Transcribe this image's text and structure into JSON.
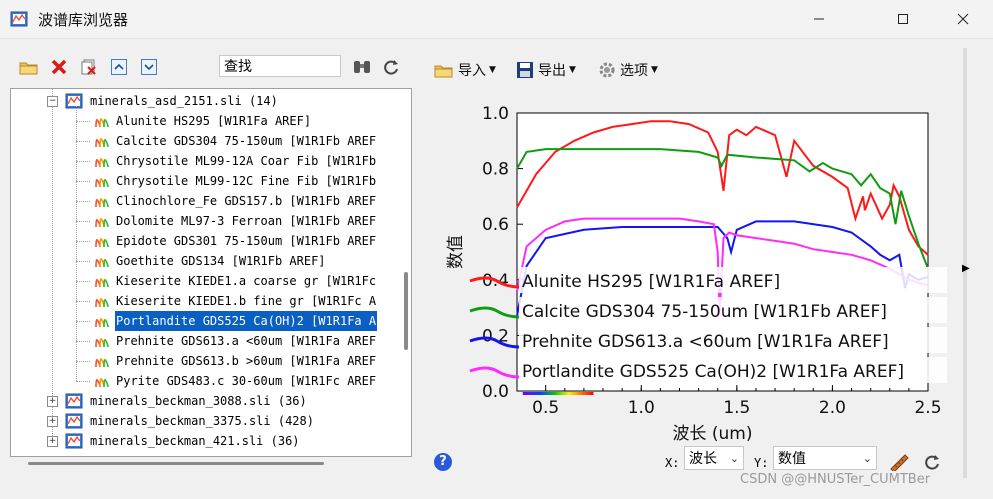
{
  "window": {
    "title": "波谱库浏览器"
  },
  "left_toolbar": {
    "search_value": "查找"
  },
  "tree": {
    "rows": [
      {
        "label": "minerals_asd_2151.sli  (14)",
        "level": 1,
        "kind": "lib",
        "expanded": true
      },
      {
        "label": "Alunite HS295 [W1R1Fa AREF]",
        "level": 2,
        "kind": "spec"
      },
      {
        "label": "Calcite GDS304 75-150um [W1R1Fb AREF",
        "level": 2,
        "kind": "spec"
      },
      {
        "label": "Chrysotile ML99-12A Coar Fib [W1R1Fb",
        "level": 2,
        "kind": "spec"
      },
      {
        "label": "Chrysotile ML99-12C Fine Fib [W1R1Fb",
        "level": 2,
        "kind": "spec"
      },
      {
        "label": "Clinochlore_Fe GDS157.b [W1R1Fb AREF",
        "level": 2,
        "kind": "spec"
      },
      {
        "label": "Dolomite ML97-3 Ferroan [W1R1Fb AREF",
        "level": 2,
        "kind": "spec"
      },
      {
        "label": "Epidote GDS301 75-150um [W1R1Fb AREF",
        "level": 2,
        "kind": "spec"
      },
      {
        "label": "Goethite GDS134 [W1R1Fb AREF]",
        "level": 2,
        "kind": "spec"
      },
      {
        "label": "Kieserite KIEDE1.a coarse gr [W1R1Fc",
        "level": 2,
        "kind": "spec"
      },
      {
        "label": "Kieserite KIEDE1.b fine gr [W1R1Fc A",
        "level": 2,
        "kind": "spec"
      },
      {
        "label": "Portlandite GDS525 Ca(OH)2 [W1R1Fa A",
        "level": 2,
        "kind": "spec",
        "selected": true
      },
      {
        "label": "Prehnite GDS613.a <60um [W1R1Fa AREF",
        "level": 2,
        "kind": "spec"
      },
      {
        "label": "Prehnite GDS613.b >60um [W1R1Fa AREF",
        "level": 2,
        "kind": "spec"
      },
      {
        "label": "Pyrite GDS483.c 30-60um [W1R1Fc AREF",
        "level": 2,
        "kind": "spec"
      },
      {
        "label": "minerals_beckman_3088.sli  (36)",
        "level": 1,
        "kind": "lib",
        "expanded": false
      },
      {
        "label": "minerals_beckman_3375.sli  (428)",
        "level": 1,
        "kind": "lib",
        "expanded": false
      },
      {
        "label": "minerals_beckman_421.sli  (36)",
        "level": 1,
        "kind": "lib",
        "expanded": false
      }
    ]
  },
  "menus": {
    "import": "导入",
    "export": "导出",
    "options": "选项"
  },
  "chart_data": {
    "type": "line",
    "xlabel": "波长 (um)",
    "ylabel": "数值",
    "xlim": [
      0.35,
      2.5
    ],
    "ylim": [
      0.0,
      1.0
    ],
    "xticks": [
      "0.5",
      "1.0",
      "1.5",
      "2.0",
      "2.5"
    ],
    "xtick_values": [
      0.5,
      1.0,
      1.5,
      2.0,
      2.5
    ],
    "yticks": [
      "0.0",
      "0.2",
      "0.4",
      "0.6",
      "0.8",
      "1.0"
    ],
    "ytick_values": [
      0.0,
      0.2,
      0.4,
      0.6,
      0.8,
      1.0
    ],
    "legend_placement": "bottom-left",
    "series": [
      {
        "name": "Alunite HS295 [W1R1Fa AREF]",
        "color": "#ff1a1a",
        "x": [
          0.35,
          0.45,
          0.55,
          0.65,
          0.75,
          0.85,
          0.95,
          1.05,
          1.15,
          1.25,
          1.35,
          1.4,
          1.43,
          1.46,
          1.5,
          1.55,
          1.6,
          1.7,
          1.76,
          1.8,
          1.9,
          2.0,
          2.08,
          2.12,
          2.16,
          2.17,
          2.2,
          2.26,
          2.3,
          2.32,
          2.35,
          2.4,
          2.45,
          2.5
        ],
        "y": [
          0.66,
          0.78,
          0.86,
          0.9,
          0.93,
          0.95,
          0.96,
          0.97,
          0.97,
          0.96,
          0.93,
          0.86,
          0.72,
          0.92,
          0.94,
          0.92,
          0.95,
          0.92,
          0.77,
          0.9,
          0.81,
          0.77,
          0.73,
          0.62,
          0.7,
          0.65,
          0.71,
          0.62,
          0.67,
          0.74,
          0.7,
          0.58,
          0.52,
          0.49
        ]
      },
      {
        "name": "Calcite GDS304 75-150um [W1R1Fb AREF]",
        "color": "#109c10",
        "x": [
          0.35,
          0.4,
          0.5,
          0.7,
          0.9,
          1.1,
          1.3,
          1.4,
          1.42,
          1.45,
          1.6,
          1.8,
          1.88,
          1.95,
          2.0,
          2.1,
          2.15,
          2.2,
          2.25,
          2.3,
          2.33,
          2.36,
          2.4,
          2.45,
          2.5
        ],
        "y": [
          0.8,
          0.86,
          0.87,
          0.87,
          0.87,
          0.87,
          0.86,
          0.84,
          0.81,
          0.85,
          0.84,
          0.83,
          0.79,
          0.82,
          0.8,
          0.78,
          0.74,
          0.78,
          0.73,
          0.71,
          0.6,
          0.72,
          0.63,
          0.53,
          0.44
        ]
      },
      {
        "name": "Prehnite GDS613.a <60um [W1R1Fa AREF]",
        "color": "#1414f0",
        "x": [
          0.35,
          0.4,
          0.5,
          0.7,
          0.9,
          1.1,
          1.3,
          1.4,
          1.45,
          1.47,
          1.5,
          1.6,
          1.8,
          2.0,
          2.1,
          2.2,
          2.25,
          2.3,
          2.35,
          2.38,
          2.4,
          2.45,
          2.5
        ],
        "y": [
          0.27,
          0.45,
          0.55,
          0.58,
          0.59,
          0.59,
          0.59,
          0.59,
          0.55,
          0.5,
          0.58,
          0.61,
          0.61,
          0.59,
          0.57,
          0.52,
          0.49,
          0.47,
          0.49,
          0.37,
          0.42,
          0.4,
          0.41
        ]
      },
      {
        "name": "Portlandite GDS525 Ca(OH)2 [W1R1Fa AREF]",
        "color": "#ff2aff",
        "x": [
          0.35,
          0.4,
          0.5,
          0.6,
          0.7,
          0.8,
          0.95,
          1.0,
          1.1,
          1.2,
          1.3,
          1.38,
          1.4,
          1.41,
          1.43,
          1.46,
          1.5,
          1.6,
          1.7,
          1.8,
          1.9,
          2.0,
          2.1,
          2.2,
          2.3,
          2.4,
          2.5
        ],
        "y": [
          0.36,
          0.52,
          0.58,
          0.61,
          0.62,
          0.62,
          0.62,
          0.62,
          0.62,
          0.62,
          0.61,
          0.6,
          0.5,
          0.27,
          0.55,
          0.57,
          0.56,
          0.55,
          0.54,
          0.53,
          0.51,
          0.5,
          0.49,
          0.47,
          0.44,
          0.4,
          0.38
        ]
      }
    ]
  },
  "bottom": {
    "x_label": "X:",
    "x_value": "波长",
    "y_label": "Y:",
    "y_value": "数值",
    "help": "?"
  },
  "watermark": "CSDN @@HNUSTer_CUMTBer",
  "colors": {
    "selection": "#0a5fc4",
    "accent_help": "#2a5ad8"
  }
}
